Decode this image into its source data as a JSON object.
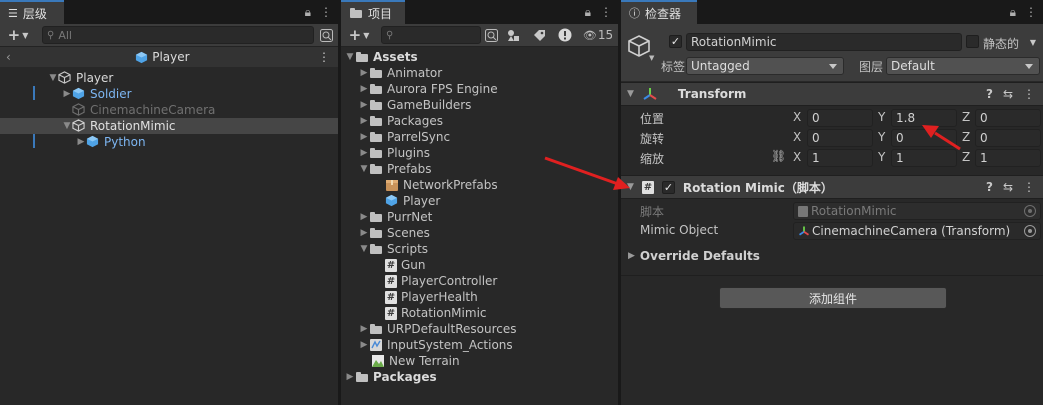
{
  "hierarchy": {
    "tab_label": "层级",
    "search_placeholder": "All",
    "scene_title": "Player",
    "items": [
      {
        "label": "Player"
      },
      {
        "label": "Soldier"
      },
      {
        "label": "CinemachineCamera"
      },
      {
        "label": "RotationMimic"
      },
      {
        "label": "Python"
      }
    ]
  },
  "project": {
    "tab_label": "项目",
    "hidden_count": "15",
    "tree": [
      {
        "label": "Assets"
      },
      {
        "label": "Animator"
      },
      {
        "label": "Aurora FPS Engine"
      },
      {
        "label": "GameBuilders"
      },
      {
        "label": "Packages"
      },
      {
        "label": "ParrelSync"
      },
      {
        "label": "Plugins"
      },
      {
        "label": "Prefabs"
      },
      {
        "label": "NetworkPrefabs"
      },
      {
        "label": "Player"
      },
      {
        "label": "PurrNet"
      },
      {
        "label": "Scenes"
      },
      {
        "label": "Scripts"
      },
      {
        "label": "Gun"
      },
      {
        "label": "PlayerController"
      },
      {
        "label": "PlayerHealth"
      },
      {
        "label": "RotationMimic"
      },
      {
        "label": "URPDefaultResources"
      },
      {
        "label": "InputSystem_Actions"
      },
      {
        "label": "New Terrain"
      },
      {
        "label": "Packages"
      }
    ]
  },
  "inspector": {
    "tab_label": "检查器",
    "object_name": "RotationMimic",
    "static_label": "静态的",
    "tag_label": "标签",
    "tag_value": "Untagged",
    "layer_label": "图层",
    "layer_value": "Default",
    "transform": {
      "title": "Transform",
      "position_label": "位置",
      "rotation_label": "旋转",
      "scale_label": "缩放",
      "axis_x": "X",
      "axis_y": "Y",
      "axis_z": "Z",
      "position": {
        "x": "0",
        "y": "1.8",
        "z": "0"
      },
      "rotation": {
        "x": "0",
        "y": "0",
        "z": "0"
      },
      "scale": {
        "x": "1",
        "y": "1",
        "z": "1"
      }
    },
    "component": {
      "title": "Rotation Mimic（脚本）",
      "script_label": "脚本",
      "script_value": "RotationMimic",
      "mimic_label": "Mimic Object",
      "mimic_value": "CinemachineCamera (Transform)",
      "override_label": "Override Defaults"
    },
    "add_component": "添加组件"
  },
  "colors": {
    "background": "#282828",
    "selection": "#464646",
    "prefab_blue": "#7db6f2",
    "annotation_red": "#e02020",
    "tab_accent": "#3a79bb"
  }
}
